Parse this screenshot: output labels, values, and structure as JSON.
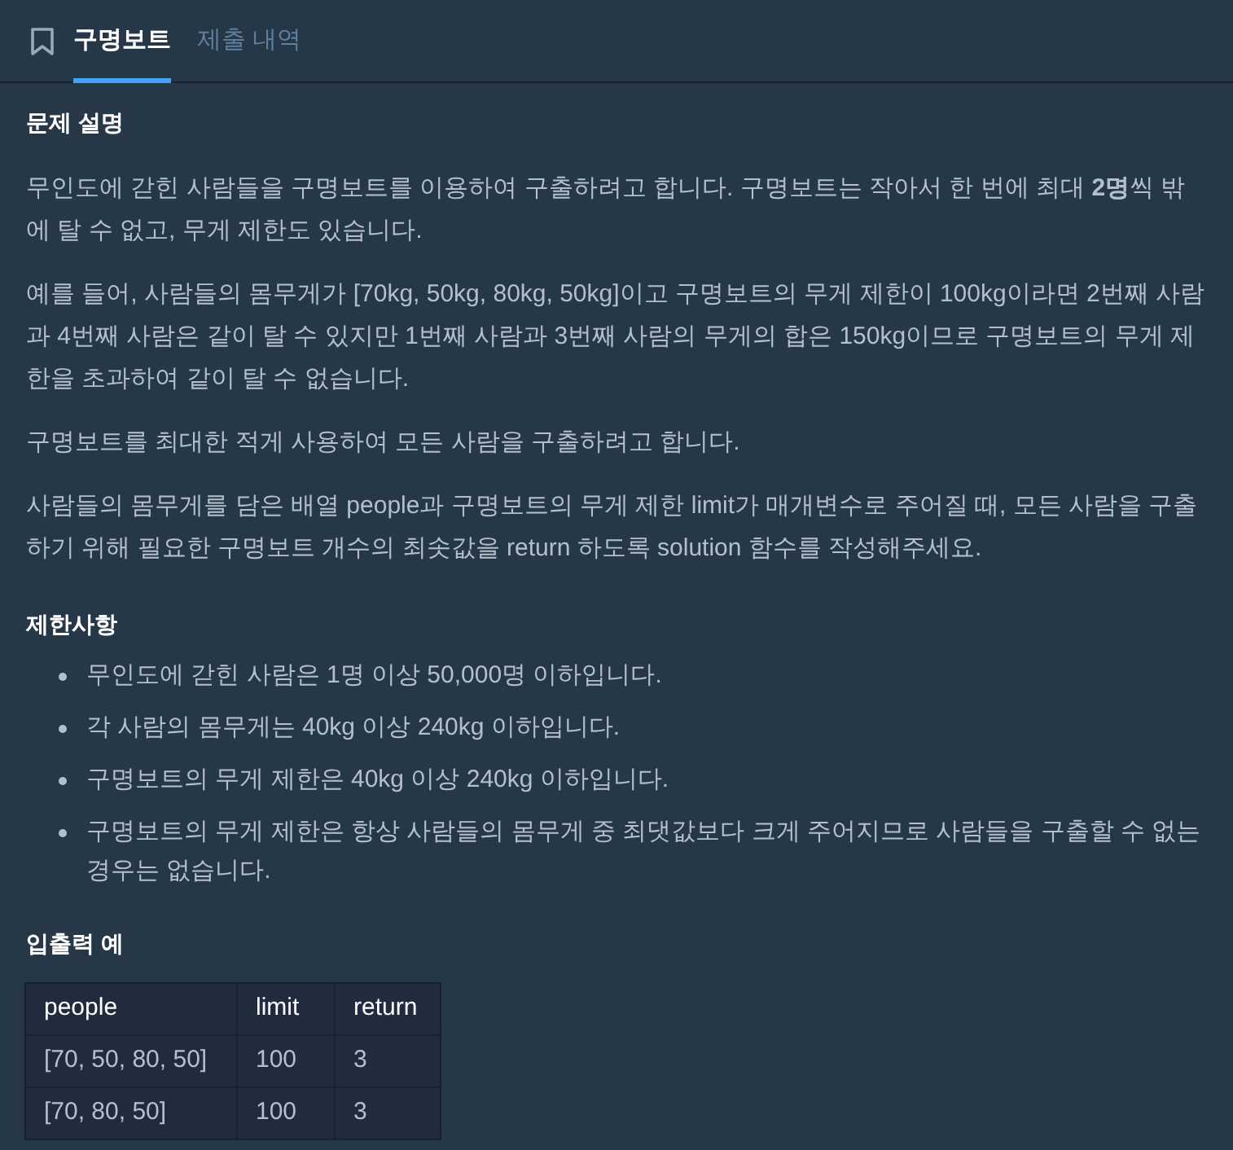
{
  "tabs": [
    {
      "label": "구명보트",
      "selected": true
    },
    {
      "label": "제출 내역",
      "selected": false
    }
  ],
  "description": {
    "heading": "문제 설명",
    "paragraphs": [
      "무인도에 갇힌 사람들을 구명보트를 이용하여 구출하려고 합니다. 구명보트는 작아서 한 번에 최대 **2명**씩 밖에 탈 수 없고, 무게 제한도 있습니다.",
      "예를 들어, 사람들의 몸무게가 [70kg, 50kg, 80kg, 50kg]이고 구명보트의 무게 제한이 100kg이라면 2번째 사람과 4번째 사람은 같이 탈 수 있지만 1번째 사람과 3번째 사람의 무게의 합은 150kg이므로 구명보트의 무게 제한을 초과하여 같이 탈 수 없습니다.",
      "구명보트를 최대한 적게 사용하여 모든 사람을 구출하려고 합니다.",
      "사람들의 몸무게를 담은 배열 people과 구명보트의 무게 제한 limit가 매개변수로 주어질 때, 모든 사람을 구출하기 위해 필요한 구명보트 개수의 최솟값을 return 하도록 solution 함수를 작성해주세요."
    ]
  },
  "constraints": {
    "heading": "제한사항",
    "items": [
      "무인도에 갇힌 사람은 1명 이상 50,000명 이하입니다.",
      "각 사람의 몸무게는 40kg 이상 240kg 이하입니다.",
      "구명보트의 무게 제한은 40kg 이상 240kg 이하입니다.",
      "구명보트의 무게 제한은 항상 사람들의 몸무게 중 최댓값보다 크게 주어지므로 사람들을 구출할 수 없는 경우는 없습니다."
    ]
  },
  "examples": {
    "heading": "입출력 예",
    "columns": [
      "people",
      "limit",
      "return"
    ],
    "rows": [
      [
        "[70, 50, 80, 50]",
        "100",
        "3"
      ],
      [
        "[70, 80, 50]",
        "100",
        "3"
      ]
    ]
  }
}
